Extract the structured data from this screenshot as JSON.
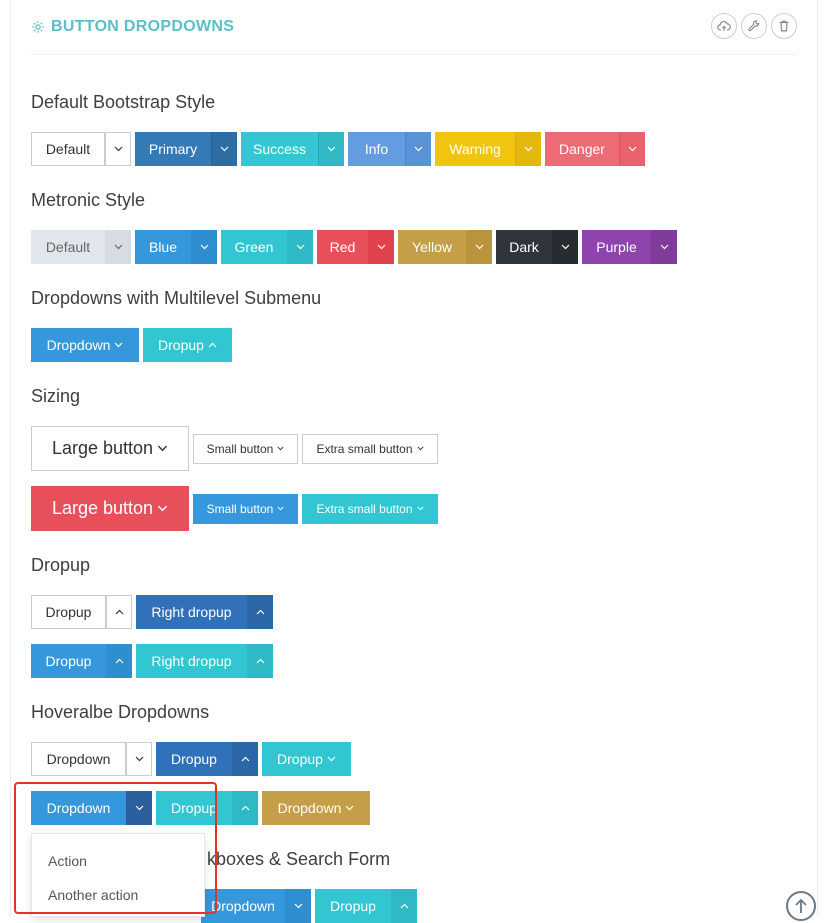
{
  "portlet": {
    "title": "BUTTON DROPDOWNS",
    "accent_color": "#5bbfc9",
    "actions": [
      "cloud-upload-icon",
      "wrench-icon",
      "trash-icon"
    ]
  },
  "sections": {
    "default_bootstrap": "Default Bootstrap Style",
    "metronic": "Metronic Style",
    "multilevel": "Dropdowns with Multilevel Submenu",
    "sizing": "Sizing",
    "dropup": "Dropup",
    "hoverable": "Hoveralbe Dropdowns",
    "checkboxes_partial": "kboxes & Search Form"
  },
  "default_bootstrap": [
    "Default",
    "Primary",
    "Success",
    "Info",
    "Warning",
    "Danger"
  ],
  "metronic": [
    "Default",
    "Blue",
    "Green",
    "Red",
    "Yellow",
    "Dark",
    "Purple"
  ],
  "multilevel": [
    "Dropdown",
    "Dropup"
  ],
  "sizing_row1": [
    "Large button",
    "Small button",
    "Extra small button"
  ],
  "sizing_row2": [
    "Large button",
    "Small button",
    "Extra small button"
  ],
  "dropup_row1": [
    "Dropup",
    "Right dropup"
  ],
  "dropup_row2": [
    "Dropup",
    "Right dropup"
  ],
  "hover_row1": [
    "Dropdown",
    "Dropup",
    "Dropup"
  ],
  "hover_row2": [
    "Dropdown",
    "Dropup",
    "Dropdown"
  ],
  "open_menu": [
    "Action",
    "Another action"
  ],
  "bottom_row": [
    "Dropdown",
    "Dropup"
  ]
}
